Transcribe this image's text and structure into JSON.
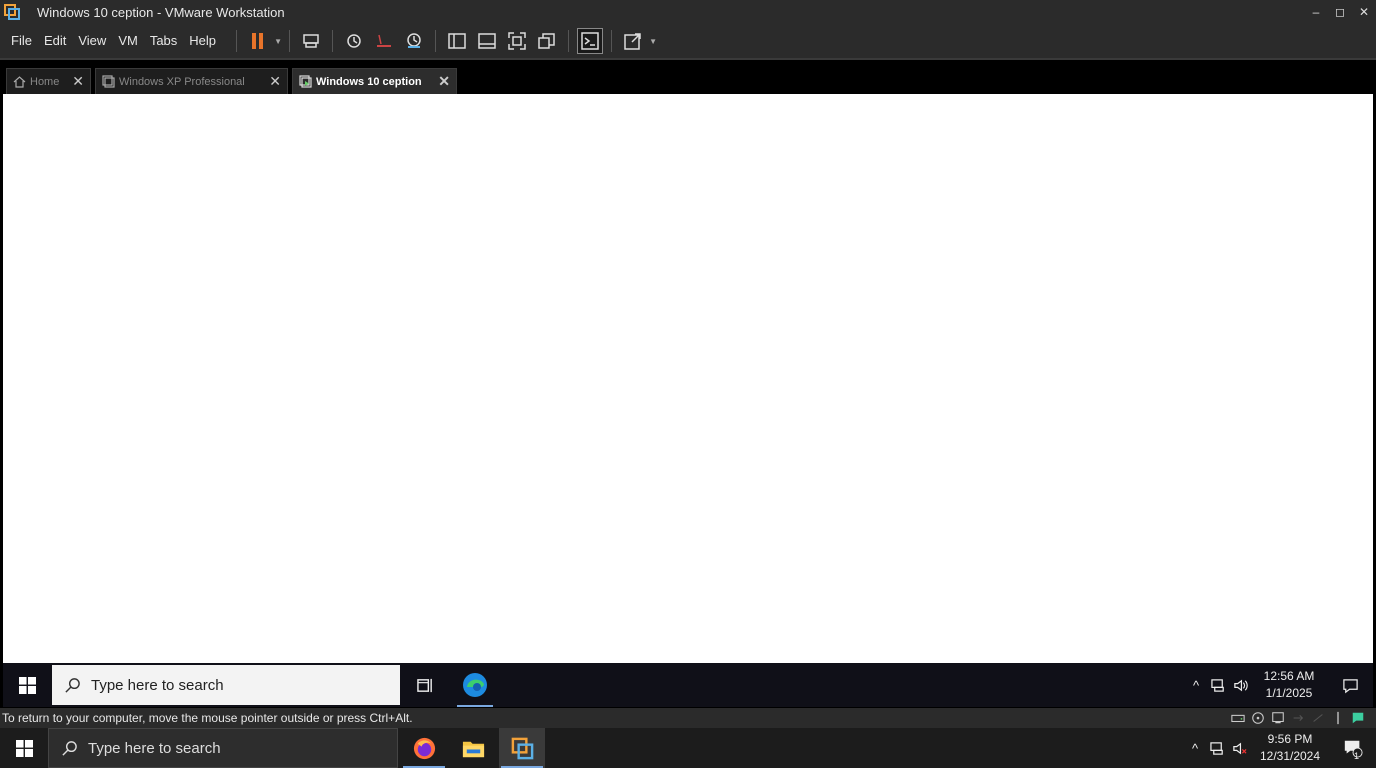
{
  "window": {
    "title": "Windows 10 ception - VMware Workstation",
    "minimize_icon": "–",
    "maximize_icon": "◻",
    "close_icon": "✕"
  },
  "menu": {
    "items": [
      "File",
      "Edit",
      "View",
      "VM",
      "Tabs",
      "Help"
    ]
  },
  "toolbar": {
    "buttons": [
      "pause-icon",
      "send-ctrl-alt-del-icon",
      "snapshot-icon",
      "revert-snapshot-icon",
      "snapshot-manager-icon",
      "library-icon",
      "thumbnail-bar-icon",
      "full-screen-icon",
      "unity-icon",
      "console-view-icon",
      "stretch-guest-icon"
    ]
  },
  "tabs": [
    {
      "label": "Home",
      "icon": "home-icon",
      "active": false
    },
    {
      "label": "Windows XP Professional",
      "icon": "vm-icon",
      "active": false
    },
    {
      "label": "Windows 10 ception",
      "icon": "vm-running-icon",
      "active": true
    }
  ],
  "tab_close_glyph": "✕",
  "guest": {
    "search_placeholder": "Type here to search",
    "clock_time": "12:56 AM",
    "clock_date": "1/1/2025"
  },
  "statusbar": {
    "message": "To return to your computer, move the mouse pointer outside or press Ctrl+Alt."
  },
  "host": {
    "search_placeholder": "Type here to search",
    "clock_time": "9:56 PM",
    "clock_date": "12/31/2024",
    "notification_count": "1"
  },
  "colors": {
    "accent_orange": "#f2a23a",
    "accent_blue": "#5bb0e6",
    "chrome_bg": "#2b2b2b",
    "taskbar_underline": "#7aa8e0"
  }
}
